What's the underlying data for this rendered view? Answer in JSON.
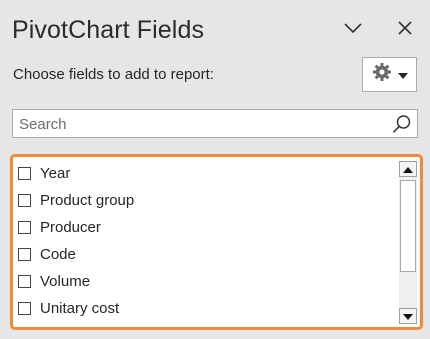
{
  "panel": {
    "title": "PivotChart Fields",
    "collapse_icon": "chevron-down-icon",
    "close_icon": "close-icon"
  },
  "toolbar": {
    "prompt": "Choose fields to add to report:",
    "settings_icon": "gear-icon",
    "dropdown_icon": "caret-down-icon"
  },
  "search": {
    "placeholder": "Search",
    "value": "",
    "icon": "search-icon"
  },
  "fields": [
    {
      "label": "Year",
      "checked": false
    },
    {
      "label": "Product group",
      "checked": false
    },
    {
      "label": "Producer",
      "checked": false
    },
    {
      "label": "Code",
      "checked": false
    },
    {
      "label": "Volume",
      "checked": false
    },
    {
      "label": "Unitary cost",
      "checked": false
    }
  ],
  "colors": {
    "highlight_border": "#ee8a3a",
    "panel_background": "#e6e6e6"
  }
}
